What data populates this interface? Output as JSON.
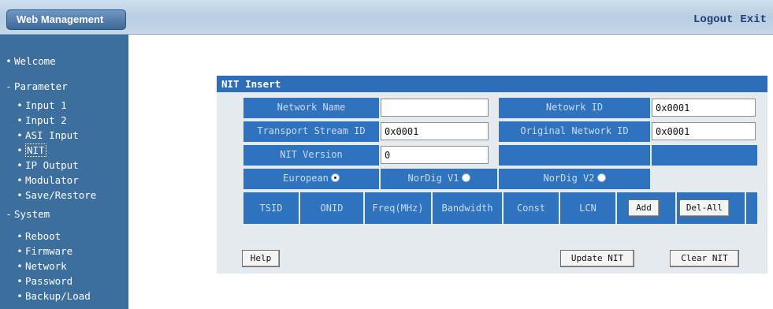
{
  "header": {
    "brand": "Web Management",
    "logout": "Logout",
    "exit": "Exit"
  },
  "sidebar": {
    "items": [
      {
        "label": "Welcome",
        "marker": "•"
      },
      {
        "label": "Parameter",
        "marker": "-"
      },
      {
        "label": "Input 1",
        "marker": "•"
      },
      {
        "label": "Input 2",
        "marker": "•"
      },
      {
        "label": "ASI Input",
        "marker": "•"
      },
      {
        "label": "NIT",
        "marker": "•"
      },
      {
        "label": "IP Output",
        "marker": "•"
      },
      {
        "label": "Modulator",
        "marker": "•"
      },
      {
        "label": "Save/Restore",
        "marker": "•"
      },
      {
        "label": "System",
        "marker": "-"
      },
      {
        "label": "Reboot",
        "marker": "•"
      },
      {
        "label": "Firmware",
        "marker": "•"
      },
      {
        "label": "Network",
        "marker": "•"
      },
      {
        "label": "Password",
        "marker": "•"
      },
      {
        "label": "Backup/Load",
        "marker": "•"
      }
    ]
  },
  "panel": {
    "title": "NIT Insert",
    "network_name_label": "Network Name",
    "network_name_value": "",
    "network_id_label": "Netowrk ID",
    "network_id_value": "0x0001",
    "ts_id_label": "Transport Stream ID",
    "ts_id_value": "0x0001",
    "orig_network_id_label": "Original Network ID",
    "orig_network_id_value": "0x0001",
    "nit_version_label": "NIT Version",
    "nit_version_value": "0",
    "mode_european": "European",
    "mode_nordig_v1": "NorDig V1",
    "mode_nordig_v2": "NorDig V2",
    "selected_mode": "European",
    "table_headers": [
      "TSID",
      "ONID",
      "Freq(MHz)",
      "Bandwidth",
      "Const",
      "LCN"
    ],
    "add_label": "Add",
    "del_all_label": "Del-All",
    "help_label": "Help",
    "update_label": "Update NIT",
    "clear_label": "Clear NIT"
  }
}
